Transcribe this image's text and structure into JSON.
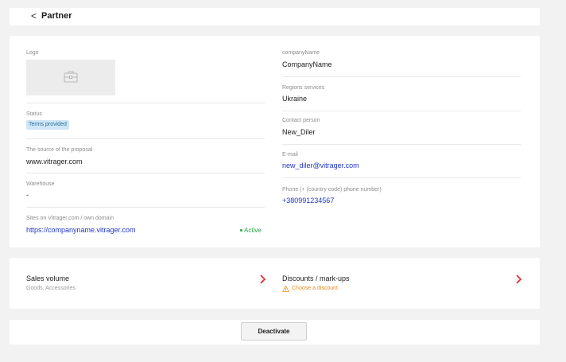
{
  "header": {
    "back_glyph": "<",
    "title": "Partner"
  },
  "info": {
    "logo_label": "Logo",
    "status_label": "Status",
    "status_badge": "Terms provided",
    "source_label": "The source of the proposal",
    "source_value": "www.vitrager.com",
    "warehouse_label": "Warehouse",
    "warehouse_value": "-",
    "sites_label": "Sites on Vitrager.com / own domain",
    "sites_value": "https://companyname.vitrager.com",
    "sites_status": "Active",
    "company_label": "companyName",
    "company_value": "CompanyName",
    "regions_label": "Regions services",
    "regions_value": "Ukraine",
    "contact_label": "Contact person",
    "contact_value": "New_Diler",
    "email_label": "E-mail",
    "email_value": "new_diler@vitrager.com",
    "phone_label": "Phone (+ (country code) phone number)",
    "phone_value": "+380991234567"
  },
  "sales": {
    "volume_title": "Sales volume",
    "volume_sub": "Goods, Accessories",
    "discounts_title": "Discounts / mark-ups",
    "discounts_warning": "Choose a discount"
  },
  "actions": {
    "deactivate_label": "Deactivate"
  },
  "colors": {
    "accent_red": "#e0252b",
    "link_blue": "#2136c8",
    "active_green": "#27a646",
    "warning_orange": "#e98c1a"
  }
}
